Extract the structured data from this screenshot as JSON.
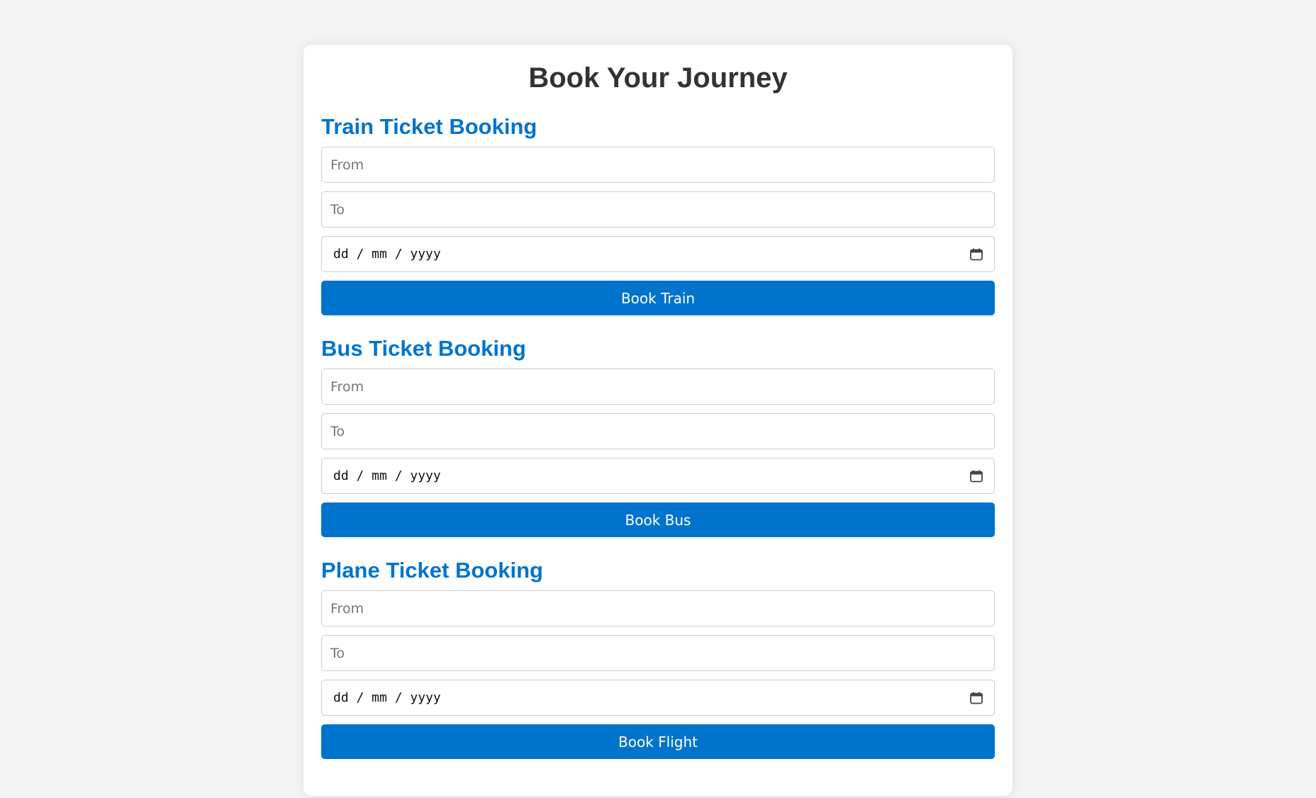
{
  "page": {
    "title": "Book Your Journey"
  },
  "colors": {
    "accent": "#0074cc",
    "background": "#f4f4f4",
    "card": "#ffffff",
    "heading": "#333333"
  },
  "sections": [
    {
      "title": "Train Ticket Booking",
      "from_placeholder": "From",
      "to_placeholder": "To",
      "date_placeholder": "dd / mm / yyyy",
      "date_icon": "calendar-icon",
      "button_label": "Book Train"
    },
    {
      "title": "Bus Ticket Booking",
      "from_placeholder": "From",
      "to_placeholder": "To",
      "date_placeholder": "dd / mm / yyyy",
      "date_icon": "calendar-icon",
      "button_label": "Book Bus"
    },
    {
      "title": "Plane Ticket Booking",
      "from_placeholder": "From",
      "to_placeholder": "To",
      "date_placeholder": "dd / mm / yyyy",
      "date_icon": "calendar-icon",
      "button_label": "Book Flight"
    }
  ]
}
